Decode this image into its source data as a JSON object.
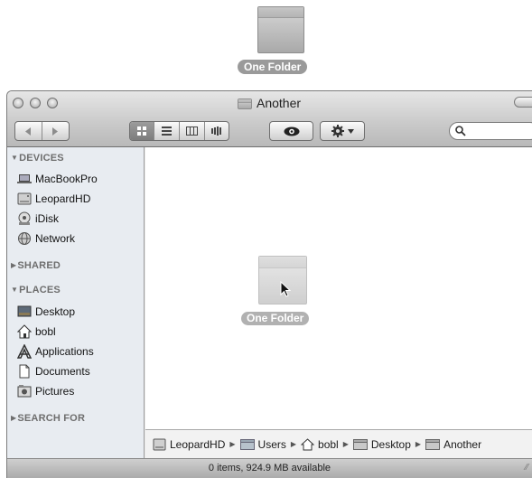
{
  "desktop": {
    "folder_label": "One Folder"
  },
  "window": {
    "title": "Another",
    "toolbar": {
      "back_icon": "chevron-left-icon",
      "forward_icon": "chevron-right-icon",
      "views": [
        "icon-view-icon",
        "list-view-icon",
        "column-view-icon",
        "coverflow-view-icon"
      ],
      "selected_view": 0,
      "quicklook_icon": "eye-icon",
      "action_icon": "gear-icon",
      "search_placeholder": ""
    }
  },
  "sidebar": {
    "devices": {
      "title": "DEVICES",
      "items": [
        {
          "label": "MacBookPro",
          "icon": "laptop-icon"
        },
        {
          "label": "LeopardHD",
          "icon": "hard-drive-icon"
        },
        {
          "label": "iDisk",
          "icon": "idisk-icon"
        },
        {
          "label": "Network",
          "icon": "network-icon"
        }
      ]
    },
    "shared": {
      "title": "SHARED"
    },
    "places": {
      "title": "PLACES",
      "items": [
        {
          "label": "Desktop",
          "icon": "desktop-icon"
        },
        {
          "label": "bobl",
          "icon": "home-icon"
        },
        {
          "label": "Applications",
          "icon": "applications-icon"
        },
        {
          "label": "Documents",
          "icon": "documents-icon"
        },
        {
          "label": "Pictures",
          "icon": "pictures-icon"
        }
      ]
    },
    "search_for": {
      "title": "SEARCH FOR"
    }
  },
  "content": {
    "dragged_folder_label": "One Folder"
  },
  "pathbar": {
    "items": [
      "LeopardHD",
      "Users",
      "bobl",
      "Desktop",
      "Another"
    ]
  },
  "status": {
    "text": "0 items, 924.9 MB available"
  },
  "colors": {
    "sidebar_bg": "#e8ecf1",
    "label_pill": "#9a9a9a"
  }
}
